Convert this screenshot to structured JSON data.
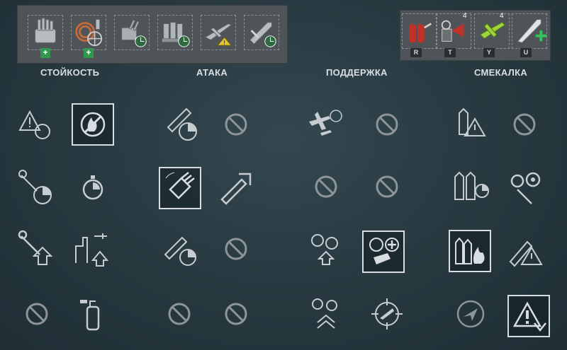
{
  "modules": {
    "slots": [
      {
        "name": "turret-mod",
        "plus": true
      },
      {
        "name": "pump-mod",
        "plus": true
      },
      {
        "name": "aa-gun-mod",
        "plus": false
      },
      {
        "name": "engine-mod",
        "plus": false
      },
      {
        "name": "plane-mod",
        "plus": false
      },
      {
        "name": "torpedo-mod",
        "plus": false
      }
    ],
    "plus_label": "+"
  },
  "consumables": {
    "items": [
      {
        "name": "damage-control",
        "key": "R"
      },
      {
        "name": "repair-party",
        "key": "T",
        "count": "4"
      },
      {
        "name": "catapult-fighter",
        "key": "Y",
        "count": "4"
      },
      {
        "name": "heal",
        "key": "U"
      }
    ]
  },
  "columns": [
    {
      "title": "СТОЙКОСТЬ"
    },
    {
      "title": "АТАКА"
    },
    {
      "title": "ПОДДЕРЖКА"
    },
    {
      "title": "СМЕКАЛКА"
    }
  ],
  "colors": {
    "accent_green": "#2f9a4f",
    "icon_stroke": "#c6ccd0",
    "selected_border": "#d7dde0"
  }
}
